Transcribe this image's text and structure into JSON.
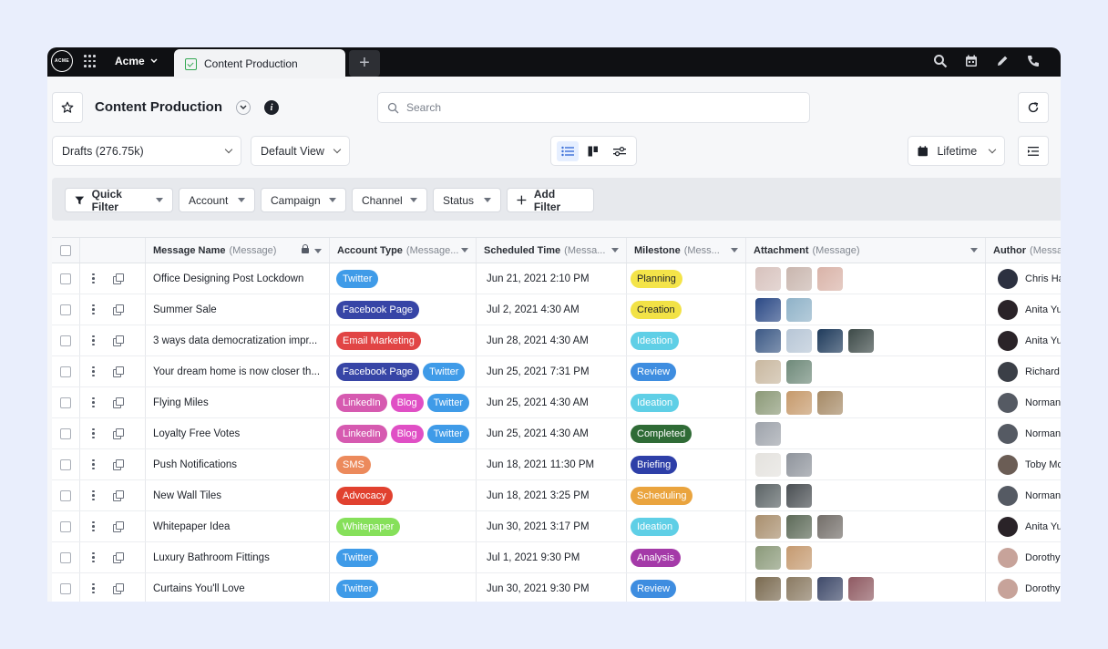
{
  "app": {
    "logo_text": "ACME",
    "workspace": "Acme",
    "active_tab": "Content Production",
    "add_tab": "+"
  },
  "header": {
    "title": "Content Production",
    "search_placeholder": "Search"
  },
  "toolbar": {
    "view_select": "Drafts (276.75k)",
    "default_view": "Default View",
    "date_range": "Lifetime"
  },
  "filters": {
    "quick_filter": "Quick Filter",
    "account": "Account",
    "campaign": "Campaign",
    "channel": "Channel",
    "status": "Status",
    "add_filter": "Add Filter"
  },
  "columns": [
    {
      "label": "Message Name",
      "sub": "(Message)"
    },
    {
      "label": "Account Type",
      "sub": "(Message..."
    },
    {
      "label": "Scheduled Time",
      "sub": "(Messa..."
    },
    {
      "label": "Milestone",
      "sub": "(Mess..."
    },
    {
      "label": "Attachment",
      "sub": "(Message)"
    },
    {
      "label": "Author",
      "sub": "(Messa"
    }
  ],
  "tag_colors": {
    "Twitter": {
      "bg": "#3f9be8",
      "fg": "#ffffff"
    },
    "Facebook Page": {
      "bg": "#3745a6",
      "fg": "#ffffff"
    },
    "Email Marketing": {
      "bg": "#e14545",
      "fg": "#ffffff"
    },
    "LinkedIn": {
      "bg": "#d65ab0",
      "fg": "#ffffff"
    },
    "Blog": {
      "bg": "#e04fc5",
      "fg": "#ffffff"
    },
    "SMS": {
      "bg": "#ec8a5c",
      "fg": "#ffffff"
    },
    "Advocacy": {
      "bg": "#e1412f",
      "fg": "#ffffff"
    },
    "Whitepaper": {
      "bg": "#86e05a",
      "fg": "#ffffff"
    }
  },
  "milestone_colors": {
    "Planning": {
      "bg": "#f4e449",
      "fg": "#1d2129"
    },
    "Creation": {
      "bg": "#f2e246",
      "fg": "#1d2129"
    },
    "Ideation": {
      "bg": "#5fcfe6",
      "fg": "#ffffff"
    },
    "Review": {
      "bg": "#3e8de0",
      "fg": "#ffffff"
    },
    "Completed": {
      "bg": "#2f6b36",
      "fg": "#ffffff"
    },
    "Briefing": {
      "bg": "#2e3fa8",
      "fg": "#ffffff"
    },
    "Scheduling": {
      "bg": "#eaa43e",
      "fg": "#ffffff"
    },
    "Analysis": {
      "bg": "#a43aa8",
      "fg": "#ffffff"
    }
  },
  "rows": [
    {
      "name": "Office Designing Post Lockdown",
      "tags": [
        "Twitter"
      ],
      "time": "Jun 21, 2021 2:10 PM",
      "milestone": "Planning",
      "thumbs": [
        "#d7c2bd",
        "#c9b6ae",
        "#d9b3a8"
      ],
      "author": "Chris Ha",
      "avatar": "#2c3140"
    },
    {
      "name": "Summer Sale",
      "tags": [
        "Facebook Page"
      ],
      "time": "Jul 2, 2021 4:30 AM",
      "milestone": "Creation",
      "thumbs": [
        "#2c4a86",
        "#8fb2c8"
      ],
      "author": "Anita Yu",
      "avatar": "#2a2328"
    },
    {
      "name": "3 ways data democratization impr...",
      "tags": [
        "Email Marketing"
      ],
      "time": "Jun 28, 2021 4:30 AM",
      "milestone": "Ideation",
      "thumbs": [
        "#3d5a86",
        "#b7c6d6",
        "#1f3b5c",
        "#3d4a48"
      ],
      "author": "Anita Yu",
      "avatar": "#2a2328"
    },
    {
      "name": "Your dream home is now closer th...",
      "tags": [
        "Facebook Page",
        "Twitter"
      ],
      "time": "Jun 25, 2021 7:31 PM",
      "milestone": "Review",
      "thumbs": [
        "#c9b8a0",
        "#6f8a7a"
      ],
      "author": "Richard M",
      "avatar": "#3b3f47"
    },
    {
      "name": "Flying Miles",
      "tags": [
        "LinkedIn",
        "Blog",
        "Twitter"
      ],
      "time": "Jun 25, 2021 4:30 AM",
      "milestone": "Ideation",
      "thumbs": [
        "#8c9a78",
        "#c69a6c",
        "#a68a66"
      ],
      "author": "Norman",
      "avatar": "#555a63"
    },
    {
      "name": "Loyalty Free Votes",
      "tags": [
        "LinkedIn",
        "Blog",
        "Twitter"
      ],
      "time": "Jun 25, 2021 4:30 AM",
      "milestone": "Completed",
      "thumbs": [
        "#9ea3ab"
      ],
      "author": "Norman",
      "avatar": "#555a63"
    },
    {
      "name": "Push Notifications",
      "tags": [
        "SMS"
      ],
      "time": "Jun 18, 2021 11:30 PM",
      "milestone": "Briefing",
      "thumbs": [
        "#e4e2de",
        "#8f949c"
      ],
      "author": "Toby Mc",
      "avatar": "#6b5d55"
    },
    {
      "name": "New Wall Tiles",
      "tags": [
        "Advocacy"
      ],
      "time": "Jun 18, 2021 3:25 PM",
      "milestone": "Scheduling",
      "thumbs": [
        "#5c6466",
        "#4a4f53"
      ],
      "author": "Norman",
      "avatar": "#555a63"
    },
    {
      "name": "Whitepaper Idea",
      "tags": [
        "Whitepaper"
      ],
      "time": "Jun 30, 2021 3:17 PM",
      "milestone": "Ideation",
      "thumbs": [
        "#a98f6e",
        "#5d6a58",
        "#736e69"
      ],
      "author": "Anita Yu",
      "avatar": "#2a2328"
    },
    {
      "name": "Luxury Bathroom Fittings",
      "tags": [
        "Twitter"
      ],
      "time": "Jul 1, 2021 9:30 PM",
      "milestone": "Analysis",
      "thumbs": [
        "#8b9a7a",
        "#c59a70"
      ],
      "author": "Dorothy",
      "avatar": "#c7a39a"
    },
    {
      "name": "Curtains You'll Love",
      "tags": [
        "Twitter"
      ],
      "time": "Jun 30, 2021 9:30 PM",
      "milestone": "Review",
      "thumbs": [
        "#7a6a50",
        "#8a7a62",
        "#3f4a6a",
        "#8f5a62"
      ],
      "author": "Dorothy",
      "avatar": "#c7a39a"
    }
  ]
}
